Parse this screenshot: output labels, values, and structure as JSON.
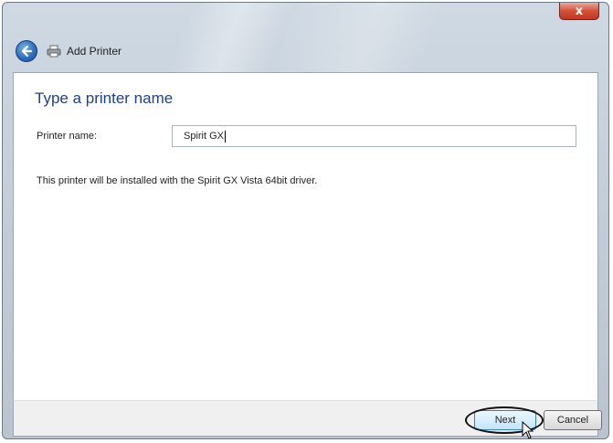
{
  "window": {
    "title": "Add Printer",
    "close_glyph": "x"
  },
  "page": {
    "heading": "Type a printer name",
    "printer_name_label": "Printer name:",
    "printer_name_value": "Spirit GX",
    "info": "This printer will be installed with the Spirit GX Vista 64bit driver."
  },
  "footer": {
    "next_label": "Next",
    "cancel_label": "Cancel"
  },
  "icons": {
    "back": "back-arrow-icon",
    "printer": "printer-icon",
    "close": "close-icon",
    "cursor": "mouse-cursor-icon"
  },
  "colors": {
    "heading": "#1f3f8f",
    "close_button": "#c2351f",
    "back_button": "#2f6fbf"
  }
}
